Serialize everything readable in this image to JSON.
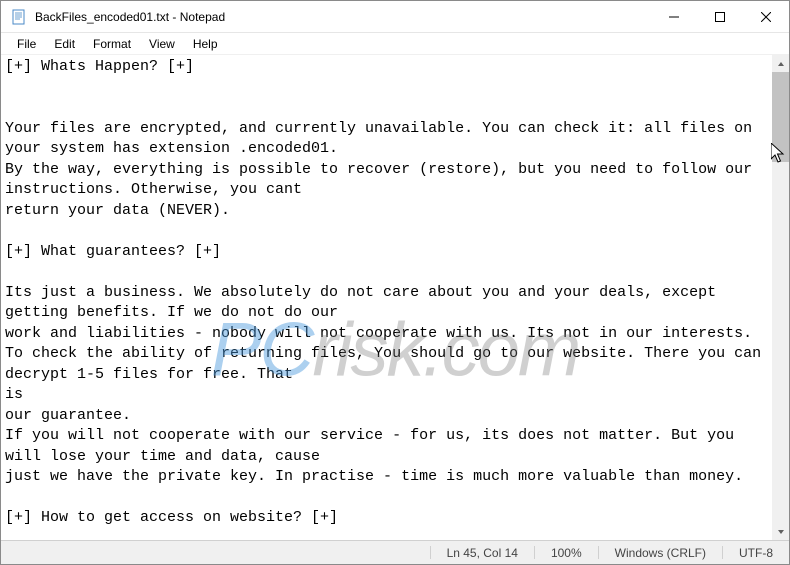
{
  "window": {
    "title": "BackFiles_encoded01.txt - Notepad"
  },
  "menu": {
    "file": "File",
    "edit": "Edit",
    "format": "Format",
    "view": "View",
    "help": "Help"
  },
  "content": {
    "text": "[+] Whats Happen? [+]\n\n\nYour files are encrypted, and currently unavailable. You can check it: all files on your system has extension .encoded01.\nBy the way, everything is possible to recover (restore), but you need to follow our instructions. Otherwise, you cant\nreturn your data (NEVER).\n\n[+] What guarantees? [+]\n\nIts just a business. We absolutely do not care about you and your deals, except getting benefits. If we do not do our\nwork and liabilities - nobody will not cooperate with us. Its not in our interests.\nTo check the ability of returning files, You should go to our website. There you can decrypt 1-5 files for free. That\nis\nour guarantee.\nIf you will not cooperate with our service - for us, its does not matter. But you will lose your time and data, cause\njust we have the private key. In practise - time is much more valuable than money.\n\n[+] How to get access on website? [+]"
  },
  "status": {
    "cursor": "Ln 45, Col 14",
    "zoom": "100%",
    "lineending": "Windows (CRLF)",
    "encoding": "UTF-8"
  },
  "watermark": {
    "prefix": "PC",
    "suffix": "risk.com"
  }
}
